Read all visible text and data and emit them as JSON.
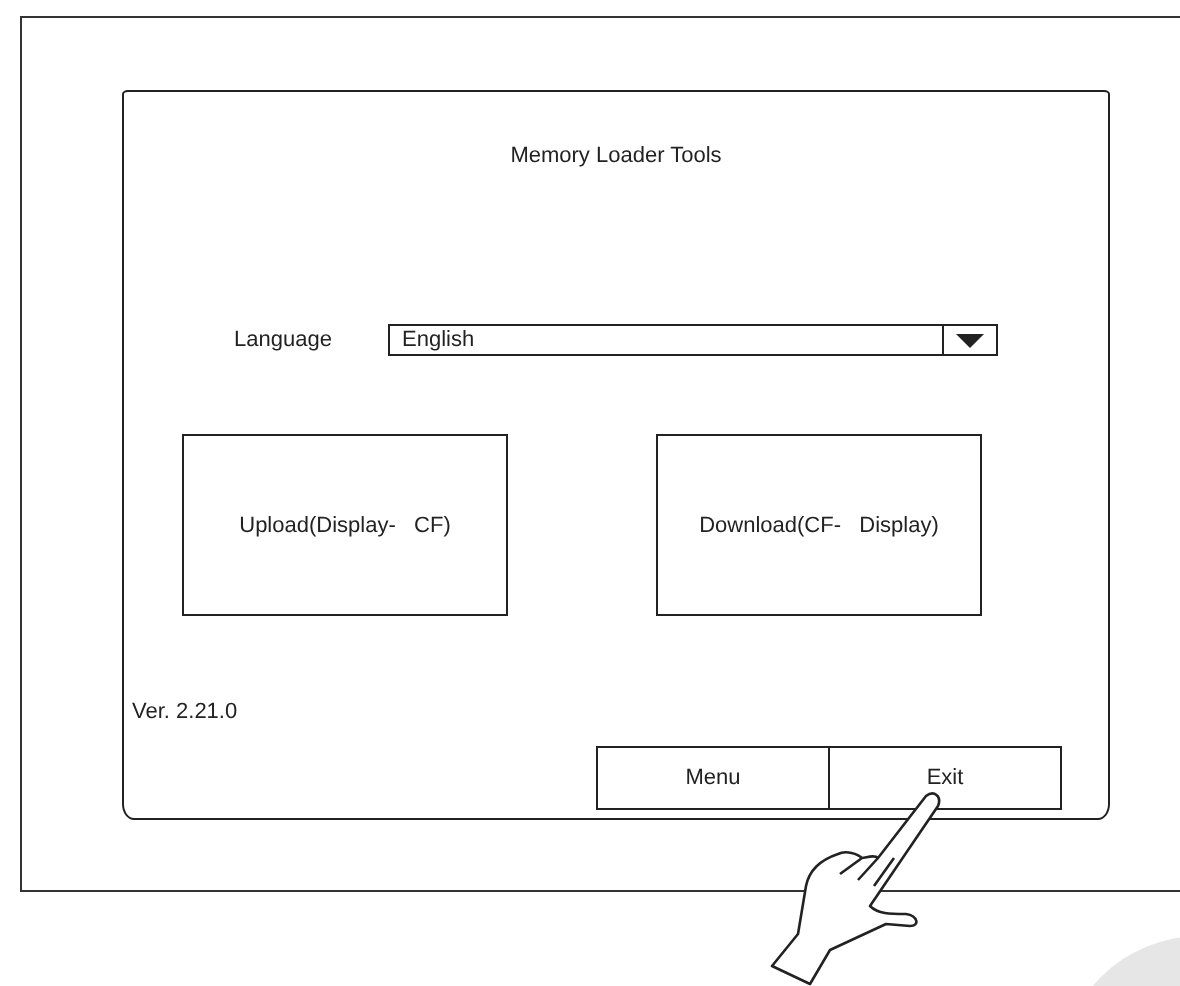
{
  "screen": {
    "title": "Memory Loader Tools",
    "language": {
      "label": "Language",
      "value": "English"
    },
    "actions": [
      {
        "label": "Upload(Display-   CF)"
      },
      {
        "label": "Download(CF-   Display)"
      }
    ],
    "version": "Ver. 2.21.0",
    "buttons": [
      {
        "label": "Menu"
      },
      {
        "label": "Exit"
      }
    ]
  }
}
